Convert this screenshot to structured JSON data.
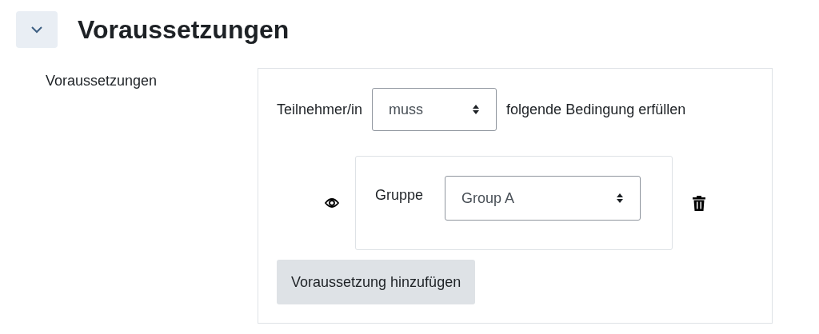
{
  "section": {
    "title": "Voraussetzungen",
    "expanded": true
  },
  "field": {
    "label": "Voraussetzungen"
  },
  "rule": {
    "prefix": "Teilnehmer/in",
    "mode": "muss",
    "suffix": "folgende Bedingung erfüllen"
  },
  "conditions": [
    {
      "label": "Gruppe",
      "value": "Group A"
    }
  ],
  "add_button": "Voraussetzung hinzufügen"
}
